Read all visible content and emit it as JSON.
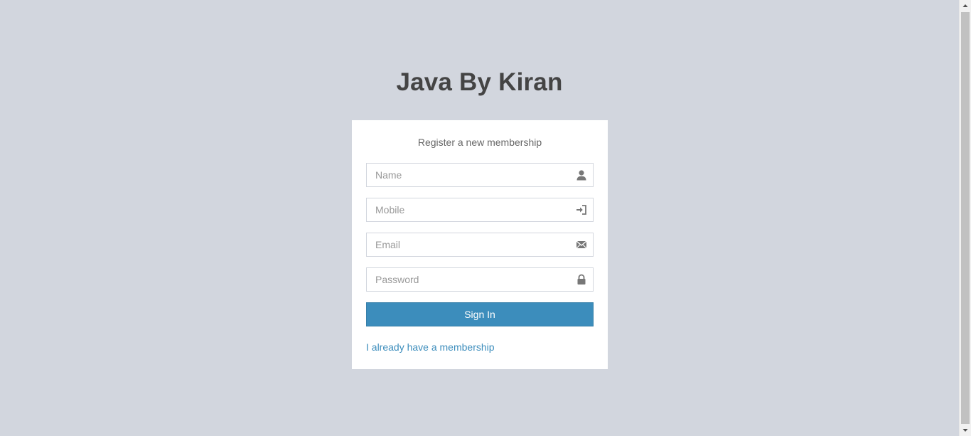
{
  "logo": {
    "title": "Java By Kiran"
  },
  "form": {
    "message": "Register a new membership",
    "fields": [
      {
        "placeholder": "Name",
        "value": "",
        "icon": "user-icon"
      },
      {
        "placeholder": "Mobile",
        "value": "",
        "icon": "log-in-icon"
      },
      {
        "placeholder": "Email",
        "value": "",
        "icon": "envelope-icon"
      },
      {
        "placeholder": "Password",
        "value": "",
        "icon": "lock-icon"
      }
    ],
    "submit_label": "Sign In",
    "login_link": "I already have a membership"
  },
  "colors": {
    "background": "#d2d6de",
    "accent": "#3c8dbc",
    "link": "#3c8dbc",
    "heading": "#444444"
  }
}
